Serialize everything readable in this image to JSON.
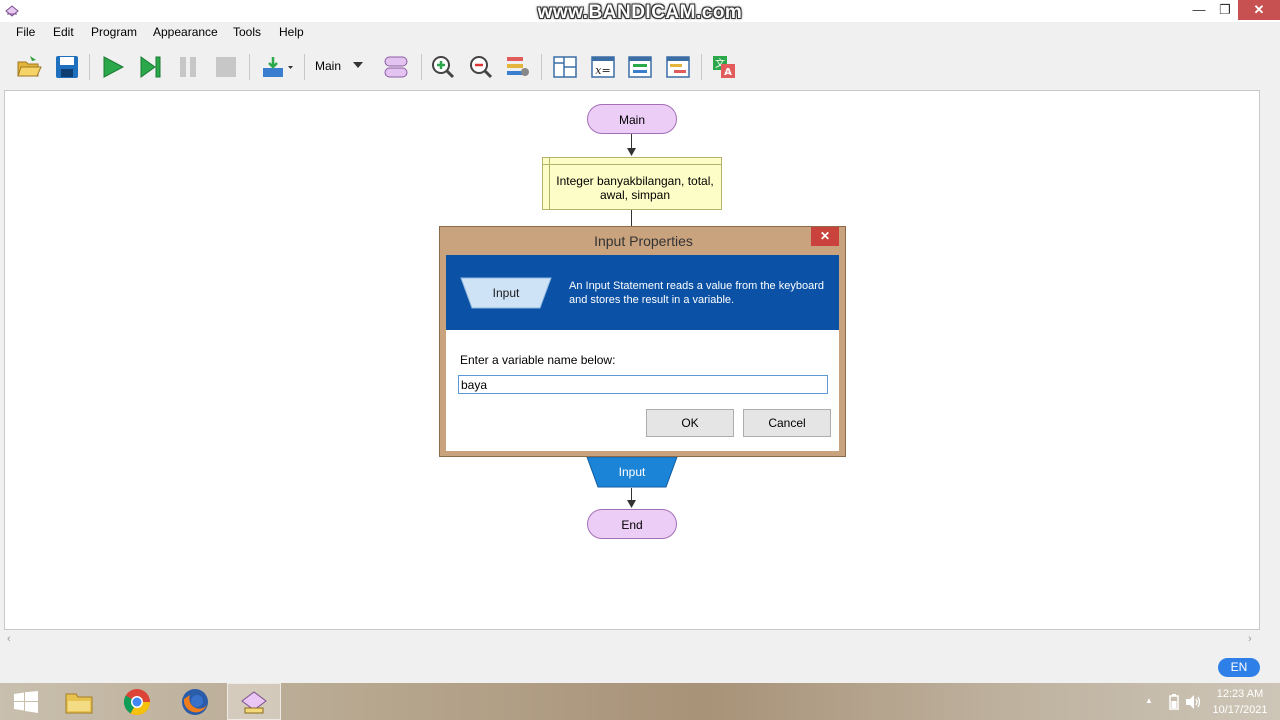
{
  "watermark": "www.BANDICAM.com",
  "window": {
    "minimize": "—",
    "maximize": "❐",
    "close": "✕"
  },
  "menu": [
    "File",
    "Edit",
    "Program",
    "Appearance",
    "Tools",
    "Help"
  ],
  "toolbar": {
    "function_select": "Main"
  },
  "flowchart": {
    "start_label": "Main",
    "declare_text": "Integer banyakbilangan, total, awal, simpan",
    "input_label": "Input",
    "end_label": "End"
  },
  "dialog": {
    "title": "Input Properties",
    "shape_label": "Input",
    "description": "An Input Statement reads a value from the keyboard and stores the result in a variable.",
    "prompt": "Enter a variable name below:",
    "input_value": "baya",
    "ok_label": "OK",
    "cancel_label": "Cancel"
  },
  "statusbar": {
    "language": "EN"
  },
  "taskbar": {
    "time": "12:23 AM",
    "date": "10/17/2021",
    "tray_arrow": "▲"
  },
  "colors": {
    "dialog_banner": "#0b52a6",
    "terminal_fill": "#ebcdf5",
    "declare_fill": "#fdfdc7",
    "input_fill": "#1c84d6"
  }
}
